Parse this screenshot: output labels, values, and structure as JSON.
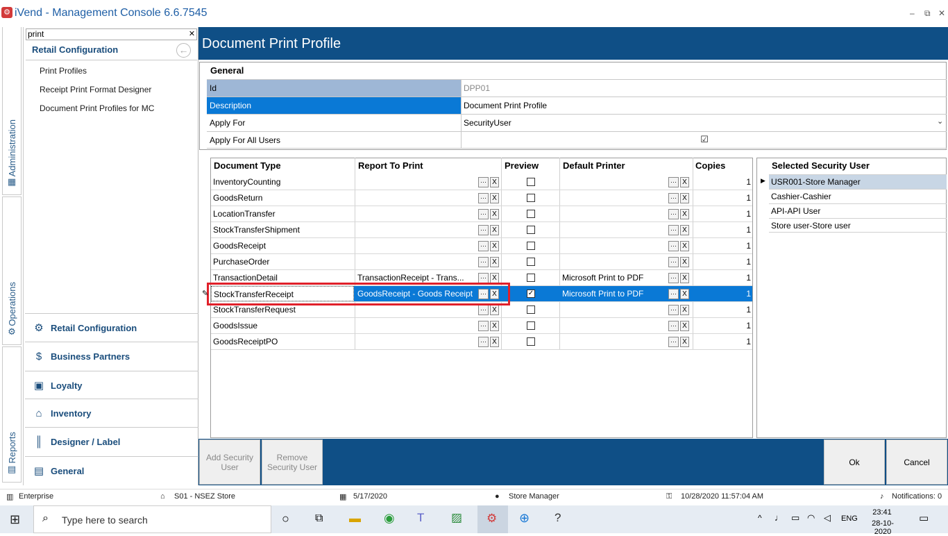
{
  "window": {
    "title": "iVend - Management Console  6.6.7545",
    "minimize": "‒",
    "restore": "⧉",
    "close": "✕"
  },
  "vtabs": [
    {
      "label": "Administration",
      "icon": "building-icon"
    },
    {
      "label": "Operations",
      "icon": "gear-icon"
    },
    {
      "label": "Reports",
      "icon": "report-icon"
    }
  ],
  "left": {
    "search_value": "print",
    "search_clear": "✕",
    "section_title": "Retail Configuration",
    "items": [
      "Print Profiles",
      "Receipt Print Format Designer",
      "Document Print Profiles for MC"
    ],
    "modules": [
      "Retail Configuration",
      "Business Partners",
      "Loyalty",
      "Inventory",
      "Designer / Label",
      "General"
    ]
  },
  "page": {
    "title": "Document Print Profile"
  },
  "general": {
    "title": "General",
    "fields": [
      {
        "label": "Id",
        "value": "DPP01"
      },
      {
        "label": "Description",
        "value": "Document Print Profile"
      },
      {
        "label": "Apply For",
        "value": "SecurityUser"
      },
      {
        "label": "Apply For All Users",
        "value": "☑"
      }
    ]
  },
  "grid": {
    "headers": [
      "Document Type",
      "Report To Print",
      "Preview",
      "Default Printer",
      "Copies"
    ],
    "ellipsis": "···",
    "clear": "X",
    "check": "✓",
    "rows": [
      {
        "doc": "InventoryCounting",
        "report": "",
        "preview": false,
        "printer": "",
        "copies": "1"
      },
      {
        "doc": "GoodsReturn",
        "report": "",
        "preview": false,
        "printer": "",
        "copies": "1"
      },
      {
        "doc": "LocationTransfer",
        "report": "",
        "preview": false,
        "printer": "",
        "copies": "1"
      },
      {
        "doc": "StockTransferShipment",
        "report": "",
        "preview": false,
        "printer": "",
        "copies": "1"
      },
      {
        "doc": "GoodsReceipt",
        "report": "",
        "preview": false,
        "printer": "",
        "copies": "1"
      },
      {
        "doc": "PurchaseOrder",
        "report": "",
        "preview": false,
        "printer": "",
        "copies": "1"
      },
      {
        "doc": "TransactionDetail",
        "report": "TransactionReceipt - Trans...",
        "preview": false,
        "printer": "Microsoft Print to PDF",
        "copies": "1"
      },
      {
        "doc": "StockTransferReceipt",
        "report": "GoodsReceipt - Goods Receipt",
        "preview": true,
        "printer": "Microsoft Print to PDF",
        "copies": "1"
      },
      {
        "doc": "StockTransferRequest",
        "report": "",
        "preview": false,
        "printer": "",
        "copies": "1"
      },
      {
        "doc": "GoodsIssue",
        "report": "",
        "preview": false,
        "printer": "",
        "copies": "1"
      },
      {
        "doc": "GoodsReceiptPO",
        "report": "",
        "preview": false,
        "printer": "",
        "copies": "1"
      }
    ],
    "selected_row": 7
  },
  "users": {
    "title": "Selected Security User",
    "items": [
      "USR001-Store Manager",
      "Cashier-Cashier",
      "API-API User",
      "Store user-Store user"
    ]
  },
  "buttons": {
    "add_user": "Add Security User",
    "remove_user": "Remove Security User",
    "ok": "Ok",
    "cancel": "Cancel"
  },
  "status": {
    "edition": "Enterprise",
    "store": "S01 - NSEZ Store",
    "date": "5/17/2020",
    "role": "Store Manager",
    "datetime": "10/28/2020 11:57:04 AM",
    "notifications": "Notifications: 0"
  },
  "taskbar": {
    "search_placeholder": "Type here to search",
    "lang": "ENG",
    "time": "23:41",
    "date": "28-10-2020"
  }
}
